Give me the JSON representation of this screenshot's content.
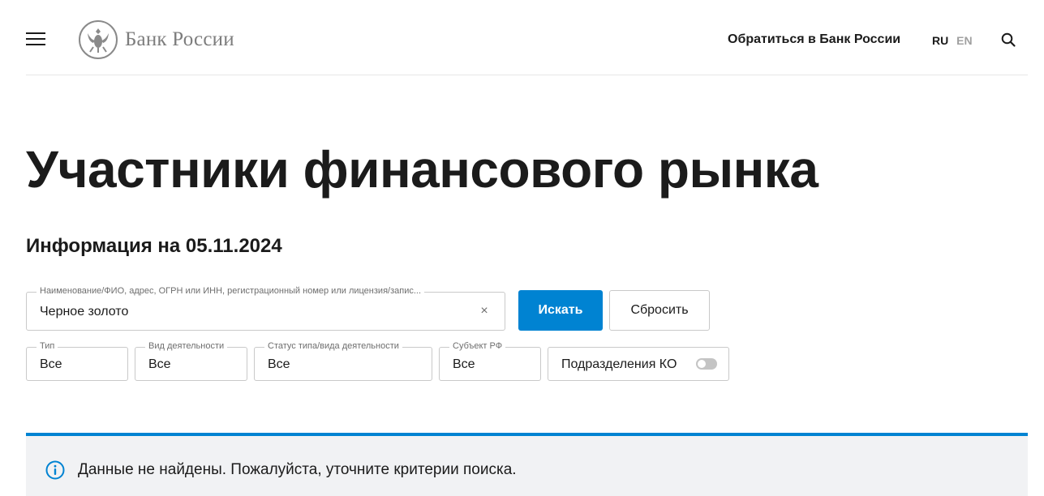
{
  "header": {
    "logo_text": "Банк России",
    "contact_link": "Обратиться в Банк России",
    "lang_ru": "RU",
    "lang_en": "EN"
  },
  "page": {
    "title": "Участники финансового рынка",
    "info_date": "Информация на 05.11.2024"
  },
  "search": {
    "label": "Наименование/ФИО, адрес, ОГРН или ИНН, регистрационный номер или лицензия/запис...",
    "value": "Черное золото",
    "clear_symbol": "×",
    "submit_label": "Искать",
    "reset_label": "Сбросить"
  },
  "filters": {
    "type": {
      "label": "Тип",
      "value": "Все"
    },
    "activity": {
      "label": "Вид деятельности",
      "value": "Все"
    },
    "status": {
      "label": "Статус типа/вида деятельности",
      "value": "Все"
    },
    "subject": {
      "label": "Субъект РФ",
      "value": "Все"
    },
    "branches": {
      "label": "Подразделения КО",
      "enabled": false
    }
  },
  "notice": {
    "text": "Данные не найдены. Пожалуйста, уточните критерии поиска."
  },
  "colors": {
    "accent": "#0083d2",
    "text": "#1b1b1b",
    "muted": "#7d7d7d",
    "notice_bg": "#f1f2f4"
  },
  "icons": [
    "menu-icon",
    "bank-emblem-icon",
    "search-icon",
    "clear-icon",
    "info-icon"
  ]
}
